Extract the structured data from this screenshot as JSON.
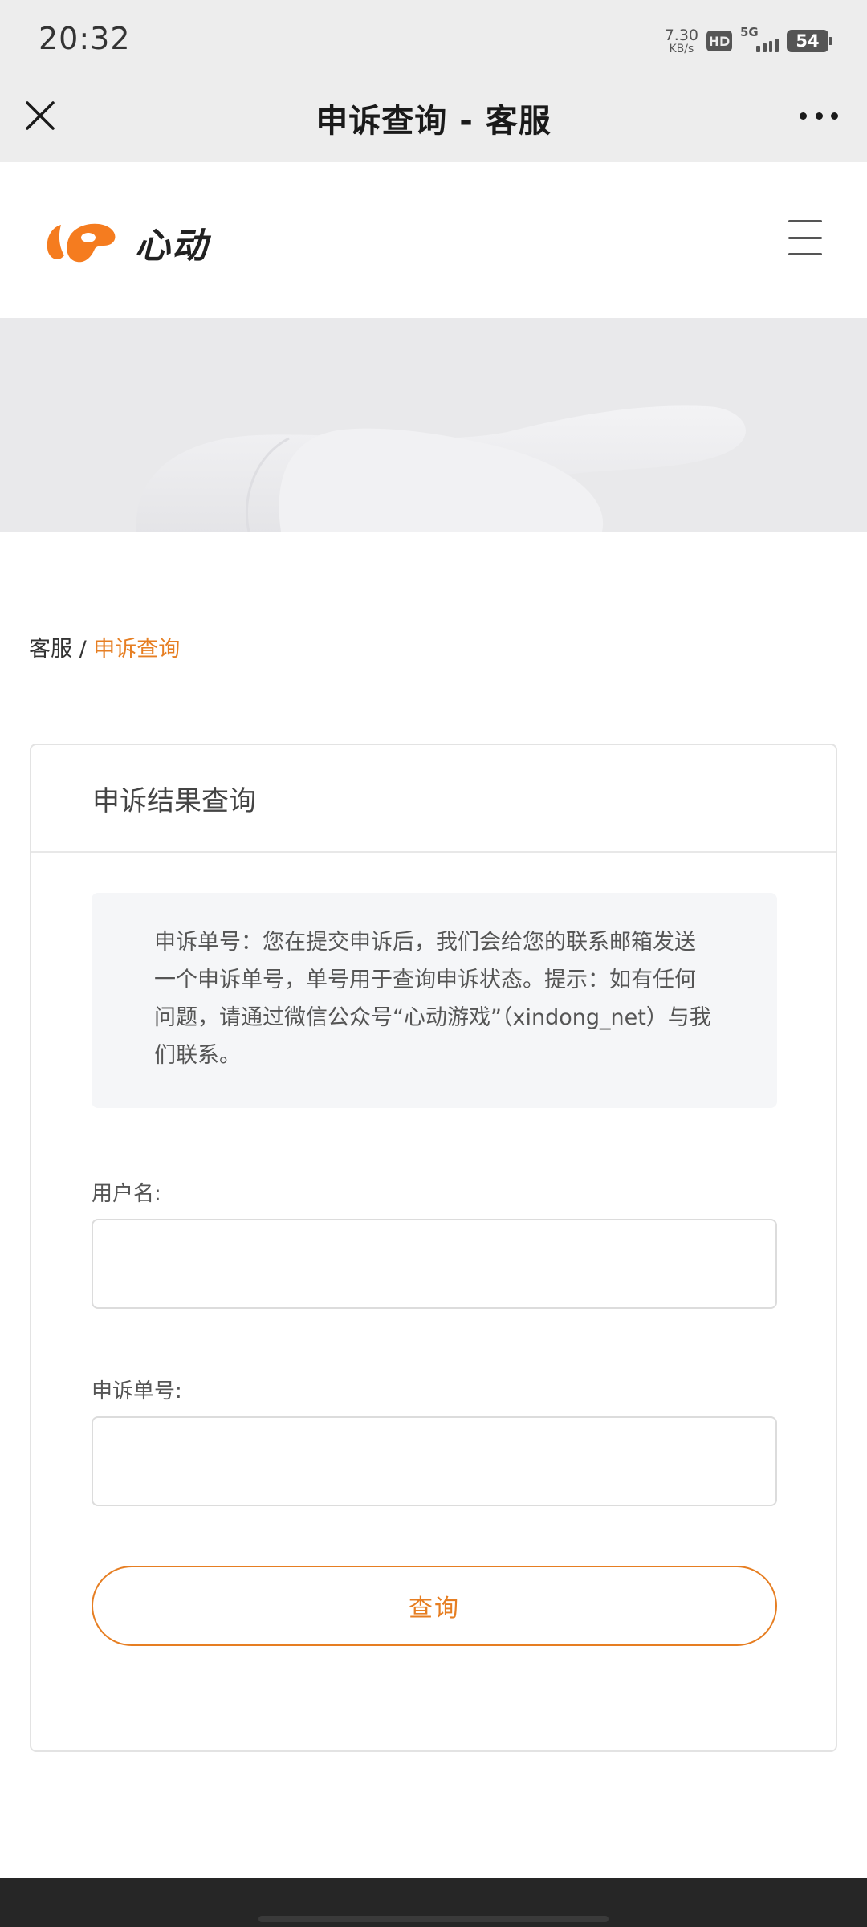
{
  "status_bar": {
    "time": "20:32",
    "net_speed_value": "7.30",
    "net_speed_unit": "KB/s",
    "hd_label": "HD",
    "network_type": "5G",
    "battery_level": "54"
  },
  "wechat_bar": {
    "title": "申诉查询 - 客服",
    "close_icon": "close-icon",
    "more_icon": "more-dots-icon"
  },
  "site_header": {
    "logo_text": "心动",
    "logo_color": "#f57c1f",
    "menu_icon": "hamburger-icon"
  },
  "breadcrumb": {
    "root": "客服",
    "separator": " / ",
    "current": "申诉查询"
  },
  "card": {
    "title": "申诉结果查询",
    "notice": "申诉单号：您在提交申诉后，我们会给您的联系邮箱发送一个申诉单号，单号用于查询申诉状态。提示：如有任何问题，请通过微信公众号“心动游戏”（xindong_net）与我们联系。",
    "username_label": "用户名:",
    "username_value": "",
    "ticket_label": "申诉单号:",
    "ticket_value": "",
    "query_button": "查询"
  },
  "colors": {
    "accent": "#e67e22",
    "chrome_bg": "#ededed",
    "footer_bg": "#262626"
  }
}
